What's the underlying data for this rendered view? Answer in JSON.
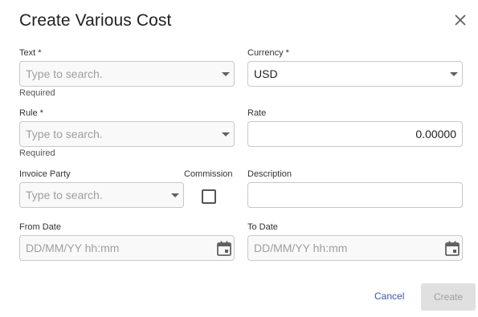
{
  "dialog": {
    "title": "Create Various Cost",
    "close_icon": "close-icon"
  },
  "form": {
    "text": {
      "label": "Text *",
      "placeholder": "Type to search.",
      "hint": "Required"
    },
    "currency": {
      "label": "Currency *",
      "value": "USD"
    },
    "rule": {
      "label": "Rule *",
      "placeholder": "Type to search.",
      "hint": "Required"
    },
    "rate": {
      "label": "Rate",
      "value": "0.00000"
    },
    "invoice_party": {
      "label": "Invoice Party",
      "placeholder": "Type to search."
    },
    "commission": {
      "label": "Commission",
      "checked": false
    },
    "description": {
      "label": "Description",
      "value": ""
    },
    "from_date": {
      "label": "From Date",
      "placeholder": "DD/MM/YY hh:mm",
      "icon": "calendar-icon"
    },
    "to_date": {
      "label": "To Date",
      "placeholder": "DD/MM/YY hh:mm",
      "icon": "calendar-icon"
    }
  },
  "actions": {
    "cancel_label": "Cancel",
    "create_label": "Create"
  },
  "colors": {
    "primary_link": "#3f51b5",
    "disabled_bg": "#e0e0e0",
    "disabled_text": "#9e9e9e",
    "border": "#c8c8c8"
  }
}
